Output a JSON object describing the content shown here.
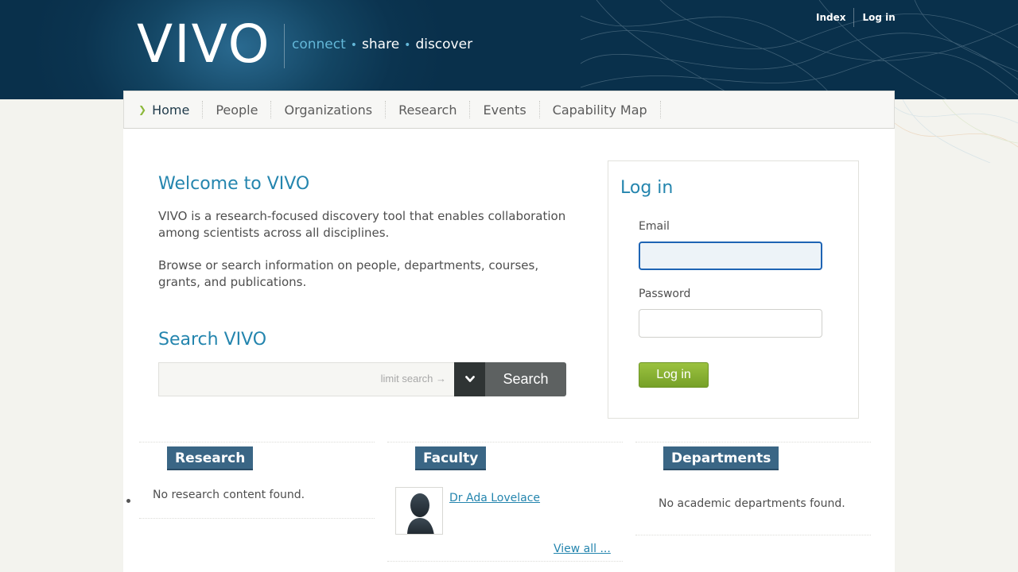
{
  "header": {
    "logo": "VIVO",
    "tagline": {
      "connect": "connect",
      "share": "share",
      "discover": "discover",
      "separator": "•"
    },
    "links": [
      {
        "label": "Index"
      },
      {
        "label": "Log in"
      }
    ]
  },
  "nav": {
    "items": [
      {
        "label": "Home",
        "active": true
      },
      {
        "label": "People"
      },
      {
        "label": "Organizations"
      },
      {
        "label": "Research"
      },
      {
        "label": "Events"
      },
      {
        "label": "Capability Map"
      }
    ]
  },
  "welcome": {
    "title": "Welcome to VIVO",
    "p1": "VIVO is a research-focused discovery tool that enables collaboration among scientists across all disciplines.",
    "p2": "Browse or search information on people, departments, courses, grants, and publications."
  },
  "search": {
    "title": "Search VIVO",
    "value": "",
    "limit_label": "limit search →",
    "button_label": "Search"
  },
  "login": {
    "title": "Log in",
    "email_label": "Email",
    "email_value": "",
    "password_label": "Password",
    "password_value": "",
    "button_label": "Log in"
  },
  "columns": {
    "research": {
      "title": "Research",
      "empty": "No research content found."
    },
    "faculty": {
      "title": "Faculty",
      "person": "Dr Ada Lovelace",
      "view_all": "View all ..."
    },
    "departments": {
      "title": "Departments",
      "empty": "No academic departments found."
    }
  },
  "colors": {
    "header_bg": "#0b3450",
    "accent_blue": "#2485ae",
    "section_head": "#3a6685",
    "login_green": "#8cb83a"
  }
}
